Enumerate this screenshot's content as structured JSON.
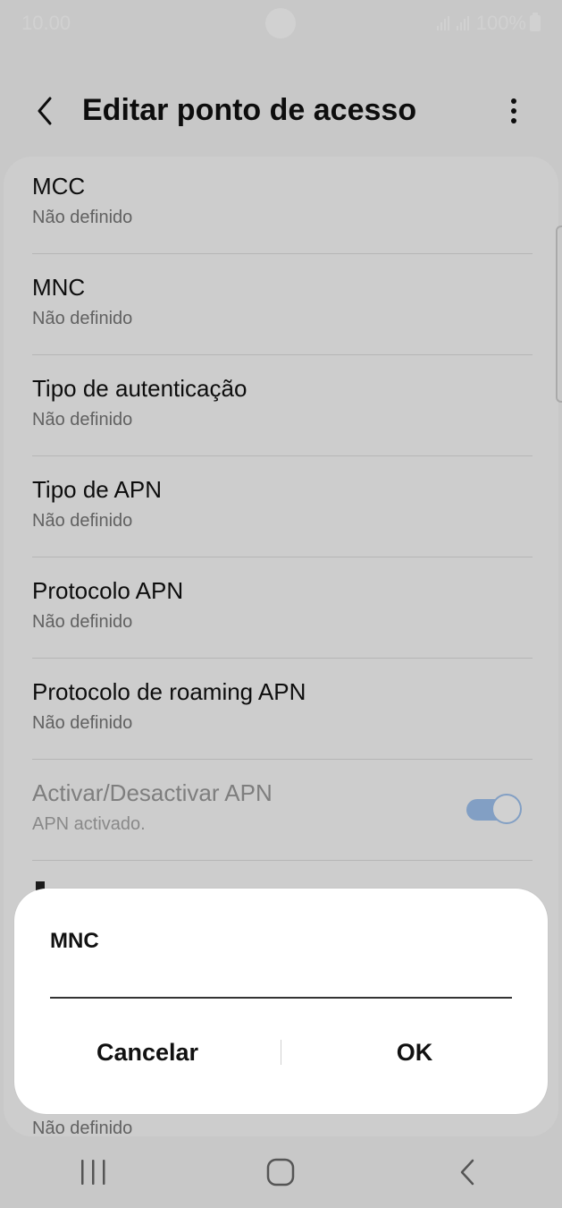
{
  "status_bar": {
    "time": "10.00",
    "battery": "100%"
  },
  "header": {
    "title": "Editar ponto de acesso"
  },
  "settings": [
    {
      "title": "MCC",
      "value": "Não definido"
    },
    {
      "title": "MNC",
      "value": "Não definido"
    },
    {
      "title": "Tipo de autenticação",
      "value": "Não definido"
    },
    {
      "title": "Tipo de APN",
      "value": "Não definido"
    },
    {
      "title": "Protocolo APN",
      "value": "Não definido"
    },
    {
      "title": "Protocolo de roaming APN",
      "value": "Não definido"
    },
    {
      "title": "Activar/Desactivar APN",
      "value": "APN activado.",
      "toggle_on": true
    }
  ],
  "peek_bottom_value": "Não definido",
  "dialog": {
    "title": "MNC",
    "input_value": "",
    "cancel_label": "Cancelar",
    "ok_label": "OK"
  },
  "colors": {
    "accent": "#3e91ff",
    "scrim": "#d9d9d9",
    "dialog_bg": "#ffffff"
  },
  "nav_icons": [
    "recent-apps-icon",
    "home-icon",
    "back-icon"
  ]
}
